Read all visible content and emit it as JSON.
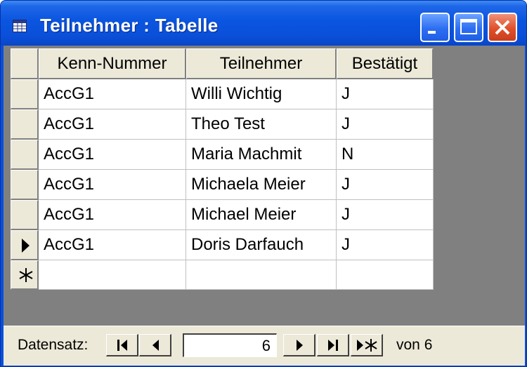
{
  "window": {
    "title": "Teilnehmer : Tabelle",
    "icon": "datasheet-table-icon"
  },
  "columns": [
    "Kenn-Nummer",
    "Teilnehmer",
    "Bestätigt"
  ],
  "rows": [
    [
      "AccG1",
      "Willi Wichtig",
      "J"
    ],
    [
      "AccG1",
      "Theo Test",
      "J"
    ],
    [
      "AccG1",
      "Maria Machmit",
      "N"
    ],
    [
      "AccG1",
      "Michaela Meier",
      "J"
    ],
    [
      "AccG1",
      "Michael Meier",
      "J"
    ],
    [
      "AccG1",
      "Doris Darfauch",
      "J"
    ]
  ],
  "current_row": 5,
  "navigation": {
    "label": "Datensatz:",
    "current_record": "6",
    "count_prefix": "von",
    "count": "6"
  },
  "colors": {
    "title_bar": "#0a55e0",
    "client_bg": "#808080",
    "header_bg": "#ece9d8",
    "close_button": "#e0502a"
  }
}
